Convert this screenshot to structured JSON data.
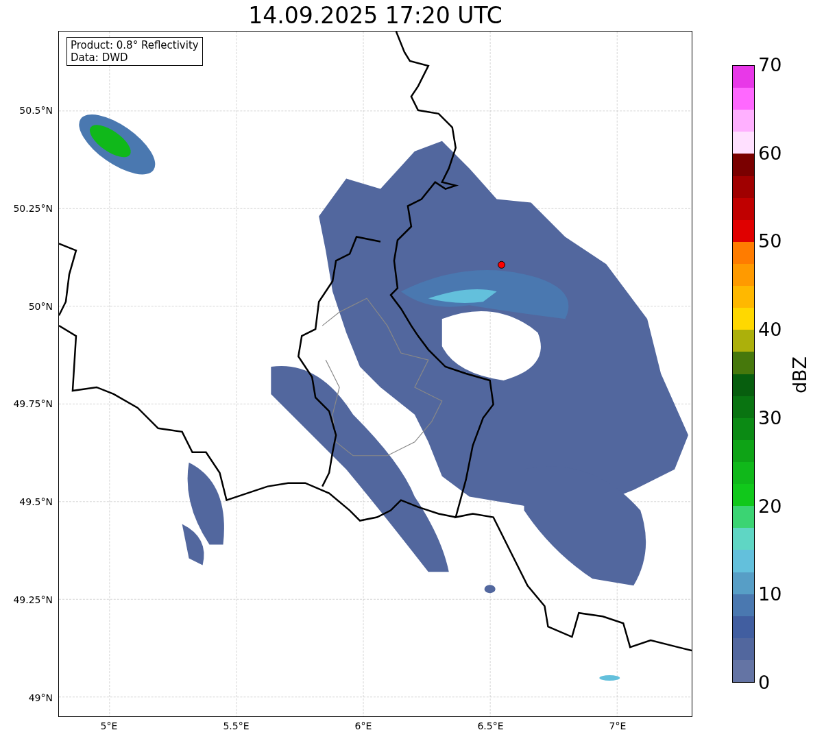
{
  "title": "14.09.2025 17:20 UTC",
  "info_box": {
    "lines": [
      "Product: 0.8° Reflectivity",
      "Data: DWD"
    ]
  },
  "x_ticks": [
    "5°E",
    "5.5°E",
    "6°E",
    "6.5°E",
    "7°E"
  ],
  "y_ticks": [
    "50.5°N",
    "50.25°N",
    "50°N",
    "49.75°N",
    "49.5°N",
    "49.25°N",
    "49°N"
  ],
  "colorbar": {
    "label": "dBZ",
    "ticks": [
      "70",
      "60",
      "50",
      "40",
      "30",
      "20",
      "10",
      "0"
    ],
    "bins": [
      {
        "color": "#e838e8"
      },
      {
        "color": "#ff68ff"
      },
      {
        "color": "#ffb0ff"
      },
      {
        "color": "#ffe0ff"
      },
      {
        "color": "#7a0000"
      },
      {
        "color": "#a00000"
      },
      {
        "color": "#c00000"
      },
      {
        "color": "#e00000"
      },
      {
        "color": "#ff7c00"
      },
      {
        "color": "#ff9a00"
      },
      {
        "color": "#ffb800"
      },
      {
        "color": "#ffd800"
      },
      {
        "color": "#acb00b"
      },
      {
        "color": "#46780c"
      },
      {
        "color": "#075e0e"
      },
      {
        "color": "#097411"
      },
      {
        "color": "#0b8a14"
      },
      {
        "color": "#0ea316"
      },
      {
        "color": "#10b81a"
      },
      {
        "color": "#11c81b"
      },
      {
        "color": "#3bd473"
      },
      {
        "color": "#5fd6c4"
      },
      {
        "color": "#63c0dc"
      },
      {
        "color": "#579ec6"
      },
      {
        "color": "#4a78b0"
      },
      {
        "color": "#415ea0"
      },
      {
        "color": "#52679e"
      },
      {
        "color": "#6474a4"
      }
    ]
  }
}
